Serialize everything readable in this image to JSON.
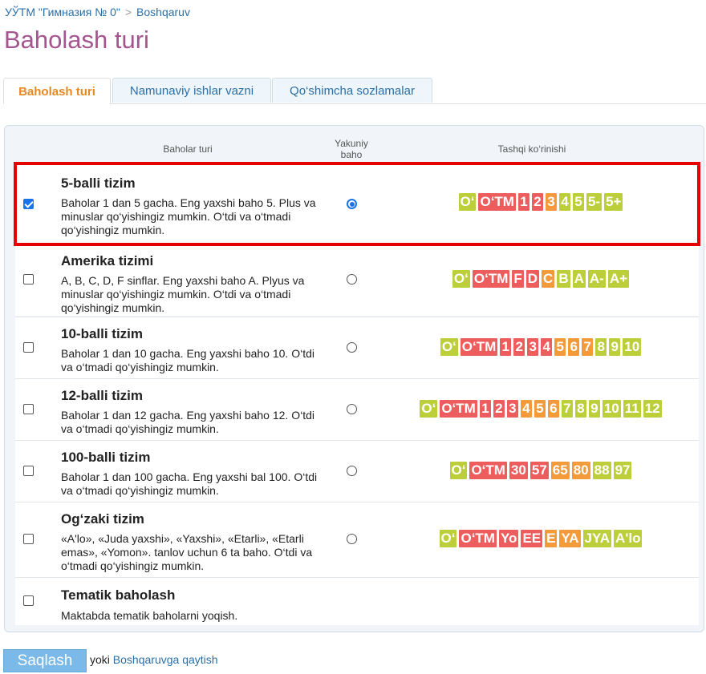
{
  "breadcrumb": {
    "school": "УЎТМ \"Гимназия № 0\"",
    "sep": ">",
    "section": "Boshqaruv"
  },
  "page_title": "Baholash turi",
  "tabs": [
    {
      "label": "Baholash turi",
      "active": true
    },
    {
      "label": "Namunaviy ishlar vazni"
    },
    {
      "label": "Qo‘shimcha sozlamalar"
    }
  ],
  "table_headers": {
    "type": "Baholar turi",
    "final_line1": "Yakuniy",
    "final_line2": "baho",
    "appearance": "Tashqi ko‘rinishi"
  },
  "colors": {
    "green": "#bccf3a",
    "red": "#ee5d5d",
    "orange": "#f39a3a",
    "selected_outline": "#e60000"
  },
  "systems": [
    {
      "name": "5-balli tizim",
      "desc": "Baholar 1 dan 5 gacha. Eng yaxshi baho 5. Plus va minuslar qo‘yishingiz mumkin. O‘tdi va o‘tmadi qo‘yishingiz mumkin.",
      "checked": true,
      "final": true,
      "grades": [
        [
          "O‘",
          "green"
        ],
        [
          "O‘TM",
          "red"
        ],
        [
          "1",
          "red"
        ],
        [
          "2",
          "red"
        ],
        [
          "3",
          "orange"
        ],
        [
          "4",
          "green"
        ],
        [
          "5",
          "green"
        ],
        [
          "5-",
          "green"
        ],
        [
          "5+",
          "green"
        ]
      ]
    },
    {
      "name": "Amerika tizimi",
      "desc": "A, B, C, D, F sinflar. Eng yaxshi baho A. Plyus va minuslar qo‘yishingiz mumkin. O‘tdi va o‘tmadi qo‘yishingiz mumkin.",
      "checked": false,
      "final": false,
      "grades": [
        [
          "O‘",
          "green"
        ],
        [
          "O‘TM",
          "red"
        ],
        [
          "F",
          "red"
        ],
        [
          "D",
          "red"
        ],
        [
          "C",
          "orange"
        ],
        [
          "B",
          "green"
        ],
        [
          "A",
          "green"
        ],
        [
          "A-",
          "green"
        ],
        [
          "A+",
          "green"
        ]
      ]
    },
    {
      "name": "10-balli tizim",
      "desc": "Baholar 1 dan 10 gacha. Eng yaxshi baho 10. O‘tdi va o‘tmadi qo‘yishingiz mumkin.",
      "checked": false,
      "final": false,
      "grades": [
        [
          "O‘",
          "green"
        ],
        [
          "O‘TM",
          "red"
        ],
        [
          "1",
          "red"
        ],
        [
          "2",
          "red"
        ],
        [
          "3",
          "red"
        ],
        [
          "4",
          "red"
        ],
        [
          "5",
          "orange"
        ],
        [
          "6",
          "orange"
        ],
        [
          "7",
          "orange"
        ],
        [
          "8",
          "green"
        ],
        [
          "9",
          "green"
        ],
        [
          "10",
          "green"
        ]
      ]
    },
    {
      "name": "12-balli tizim",
      "desc": "Baholar 1 dan 12 gacha. Eng yaxshi baho 12. O‘tdi va o‘tmadi qo‘yishingiz mumkin.",
      "checked": false,
      "final": false,
      "grades": [
        [
          "O‘",
          "green"
        ],
        [
          "O‘TM",
          "red"
        ],
        [
          "1",
          "red"
        ],
        [
          "2",
          "red"
        ],
        [
          "3",
          "red"
        ],
        [
          "4",
          "orange"
        ],
        [
          "5",
          "orange"
        ],
        [
          "6",
          "orange"
        ],
        [
          "7",
          "green"
        ],
        [
          "8",
          "green"
        ],
        [
          "9",
          "green"
        ],
        [
          "10",
          "green"
        ],
        [
          "11",
          "green"
        ],
        [
          "12",
          "green"
        ]
      ]
    },
    {
      "name": "100-balli tizim",
      "desc": "Baholar 1 dan 100 gacha. Eng yaxshi bal 100. O‘tdi va o‘tmadi qo‘yishingiz mumkin.",
      "checked": false,
      "final": false,
      "grades": [
        [
          "O‘",
          "green"
        ],
        [
          "O‘TM",
          "red"
        ],
        [
          "30",
          "red"
        ],
        [
          "57",
          "red"
        ],
        [
          "65",
          "orange"
        ],
        [
          "80",
          "orange"
        ],
        [
          "88",
          "green"
        ],
        [
          "97",
          "green"
        ]
      ]
    },
    {
      "name": "Og‘zaki tizim",
      "desc": "«A'lo», «Juda yaxshi», «Yaxshi», «Etarli», «Etarli emas», «Yomon». tanlov uchun 6 ta baho. O‘tdi va o‘tmadi qo‘yishingiz mumkin.",
      "checked": false,
      "final": false,
      "grades": [
        [
          "O‘",
          "green"
        ],
        [
          "O‘TM",
          "red"
        ],
        [
          "Yo",
          "red"
        ],
        [
          "EE",
          "red"
        ],
        [
          "E",
          "orange"
        ],
        [
          "YA",
          "orange"
        ],
        [
          "JYA",
          "green"
        ],
        [
          "A'lo",
          "green"
        ]
      ]
    },
    {
      "name": "Tematik baholash",
      "desc": "Maktabda tematik baholarni yoqish.",
      "checked": false,
      "final": null,
      "grades": []
    }
  ],
  "footer": {
    "save_label": "Saqlash",
    "or_text": "yoki",
    "back_link": "Boshqaruvga qaytish"
  }
}
